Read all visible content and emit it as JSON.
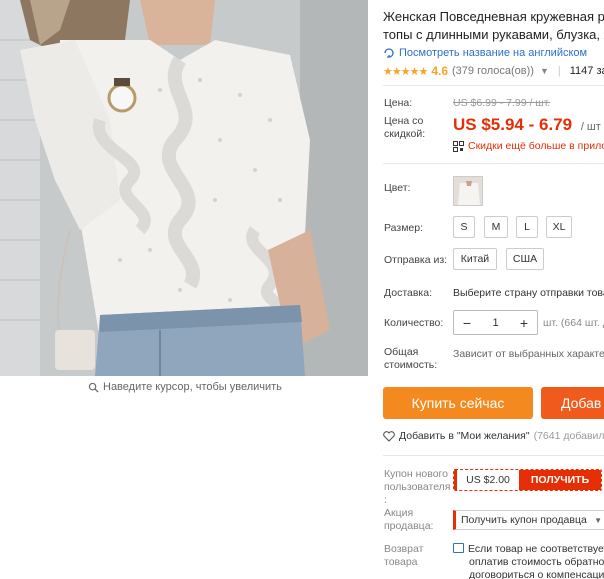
{
  "product": {
    "title_line1": "Женская Повседневная кружевная ру",
    "title_line2": "топы с длинными рукавами, блузка, ж",
    "translate_link": "Посмотреть название на английском",
    "rating_stars": "★★★★★",
    "rating_value": "4.6",
    "votes": "(379 голоса(ов))",
    "orders": "1147 за"
  },
  "price": {
    "label": "Цена:",
    "old": "US $6.99 - 7.99 / шт.",
    "discount_label": "Цена со скидкой:",
    "new": "US $5.94 - 6.79",
    "unit": "/ шт",
    "app_discount": "Скидки ещё больше в прило"
  },
  "options": {
    "color_label": "Цвет:",
    "size_label": "Размер:",
    "sizes": [
      "S",
      "M",
      "L",
      "XL"
    ],
    "ship_from_label": "Отправка из:",
    "ship_from": [
      "Китай",
      "США"
    ],
    "delivery_label": "Доставка:",
    "delivery_value": "Выберите страну отправки това",
    "qty_label": "Количество:",
    "qty_value": "1",
    "qty_minus": "−",
    "qty_plus": "+",
    "qty_available": "шт. (664 шт. д",
    "total_label": "Общая стоимость:",
    "total_value": "Зависит от выбранных характер"
  },
  "actions": {
    "buy_now": "Купить сейчас",
    "add_to_cart": "Добав",
    "wishlist": "Добавить в \"Мои желания\"",
    "wishlist_count": "(7641 добавили"
  },
  "coupons": {
    "new_user_label": "Купон нового пользователя :",
    "new_user_amount": "US $2.00",
    "get_button": "ПОЛУЧИТЬ",
    "seller_label": "Акция продавца:",
    "seller_select": "Получить купон продавца",
    "return_label": "Возврат товара",
    "return_text_1": "Если товар не соответствует",
    "return_text_2": "оплатив стоимость обратно",
    "return_text_3": "договориться о компенсаци"
  },
  "image": {
    "zoom_hint": "Наведите курсор, чтобы увеличить"
  },
  "colors": {
    "accent": "#e62e04",
    "buy_button": "#f48a1f",
    "cart_button": "#f05a1c",
    "link": "#2b70c9",
    "star": "#f5a623"
  }
}
